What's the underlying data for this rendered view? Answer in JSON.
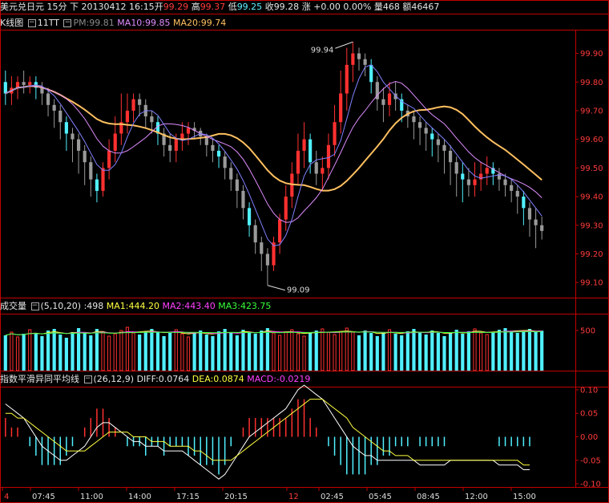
{
  "header": {
    "symbol": "美元兑日元",
    "period": "15分",
    "direction": "下",
    "datetime": "20130412 16:15",
    "open_label": "开",
    "open": "99.29",
    "high_label": "高",
    "high": "99.37",
    "low_label": "低",
    "low": "99.25",
    "close_label": "收",
    "close": "99.28",
    "change_label": "涨",
    "change": "+0.00",
    "change_pct": "0.00%",
    "volume_label": "量",
    "volume": "468",
    "amount_label": "额",
    "amount": "46467"
  },
  "kline_legend": {
    "title": "K线图",
    "indicator": "11TT",
    "pm": "PM:99.81",
    "ma10": "MA10:99.85",
    "ma20": "MA20:99.74"
  },
  "volume_legend": {
    "title": "成交量",
    "params": "(5,10,20)",
    "value": ":498",
    "ma1": "MA1:444.20",
    "ma2": "MA2:443.40",
    "ma3": "MA3:423.75"
  },
  "macd_legend": {
    "title": "指数平滑异同平均线",
    "params": "(26,12,9)",
    "diff": "DIFF:0.0764",
    "dea": "DEA:0.0874",
    "macd": "MACD:-0.0219"
  },
  "annotations": {
    "high_mark": "99.94",
    "low_mark": "99.09"
  },
  "colors": {
    "up": "#ff3030",
    "down_gray": "#9a9a9a",
    "down_cyan": "#50f0ff",
    "ma20": "#ffc060",
    "ma10": "#e08cff",
    "pm": "#8080ff",
    "frame": "#c00000",
    "axis_text": "#ff3b3b"
  },
  "chart_data": [
    {
      "type": "candlestick",
      "title": "K线图",
      "y_ticks": [
        "99.90",
        "99.80",
        "99.70",
        "99.60",
        "99.50",
        "99.40",
        "99.30",
        "99.20",
        "99.10"
      ],
      "ylim": [
        99.05,
        99.98
      ],
      "open": [
        99.8,
        99.76,
        99.78,
        99.8,
        99.79,
        99.8,
        99.78,
        99.76,
        99.72,
        99.7,
        99.66,
        99.62,
        99.6,
        99.56,
        99.52,
        99.46,
        99.42,
        99.5,
        99.56,
        99.62,
        99.66,
        99.7,
        99.74,
        99.72,
        99.68,
        99.66,
        99.62,
        99.58,
        99.56,
        99.6,
        99.62,
        99.64,
        99.63,
        99.61,
        99.58,
        99.56,
        99.54,
        99.5,
        99.46,
        99.42,
        99.36,
        99.3,
        99.24,
        99.2,
        99.16,
        99.24,
        99.32,
        99.4,
        99.48,
        99.56,
        99.6,
        99.52,
        99.48,
        99.5,
        99.58,
        99.66,
        99.76,
        99.86,
        99.9,
        99.88,
        99.86,
        99.8,
        99.74,
        99.72,
        99.76,
        99.74,
        99.7,
        99.68,
        99.66,
        99.64,
        99.62,
        99.6,
        99.58,
        99.56,
        99.52,
        99.48,
        99.46,
        99.44,
        99.46,
        99.48,
        99.5,
        99.48,
        99.46,
        99.44,
        99.42,
        99.4,
        99.36,
        99.32,
        99.3
      ],
      "high": [
        99.84,
        99.82,
        99.82,
        99.84,
        99.82,
        99.82,
        99.8,
        99.78,
        99.74,
        99.72,
        99.68,
        99.64,
        99.62,
        99.58,
        99.54,
        99.48,
        99.52,
        99.6,
        99.68,
        99.76,
        99.76,
        99.76,
        99.76,
        99.74,
        99.7,
        99.68,
        99.64,
        99.62,
        99.62,
        99.66,
        99.66,
        99.66,
        99.64,
        99.62,
        99.6,
        99.58,
        99.56,
        99.52,
        99.48,
        99.44,
        99.38,
        99.32,
        99.26,
        99.22,
        99.26,
        99.34,
        99.44,
        99.52,
        99.62,
        99.66,
        99.62,
        99.56,
        99.54,
        99.62,
        99.72,
        99.84,
        99.92,
        99.94,
        99.92,
        99.9,
        99.88,
        99.82,
        99.78,
        99.8,
        99.8,
        99.76,
        99.72,
        99.7,
        99.68,
        99.66,
        99.64,
        99.62,
        99.6,
        99.58,
        99.54,
        99.52,
        99.5,
        99.52,
        99.52,
        99.54,
        99.52,
        99.5,
        99.48,
        99.46,
        99.44,
        99.42,
        99.38,
        99.36,
        99.33
      ],
      "low": [
        99.72,
        99.72,
        99.74,
        99.76,
        99.76,
        99.74,
        99.72,
        99.68,
        99.64,
        99.6,
        99.56,
        99.52,
        99.48,
        99.44,
        99.4,
        99.38,
        99.4,
        99.46,
        99.52,
        99.58,
        99.62,
        99.66,
        99.68,
        99.64,
        99.62,
        99.58,
        99.54,
        99.52,
        99.52,
        99.56,
        99.58,
        99.6,
        99.58,
        99.54,
        99.52,
        99.5,
        99.46,
        99.42,
        99.36,
        99.32,
        99.26,
        99.2,
        99.14,
        99.09,
        99.14,
        99.2,
        99.28,
        99.36,
        99.44,
        99.5,
        99.48,
        99.44,
        99.42,
        99.46,
        99.54,
        99.62,
        99.7,
        99.8,
        99.84,
        99.82,
        99.76,
        99.7,
        99.66,
        99.68,
        99.7,
        99.66,
        99.64,
        99.6,
        99.58,
        99.56,
        99.54,
        99.52,
        99.48,
        99.44,
        99.4,
        99.38,
        99.4,
        99.4,
        99.42,
        99.44,
        99.44,
        99.42,
        99.4,
        99.38,
        99.34,
        99.3,
        99.26,
        99.22,
        99.25
      ],
      "close": [
        99.76,
        99.78,
        99.8,
        99.79,
        99.8,
        99.78,
        99.76,
        99.72,
        99.7,
        99.66,
        99.62,
        99.6,
        99.56,
        99.52,
        99.46,
        99.42,
        99.5,
        99.56,
        99.62,
        99.66,
        99.7,
        99.74,
        99.72,
        99.68,
        99.66,
        99.62,
        99.58,
        99.56,
        99.6,
        99.62,
        99.64,
        99.63,
        99.61,
        99.58,
        99.56,
        99.54,
        99.5,
        99.46,
        99.42,
        99.36,
        99.3,
        99.24,
        99.2,
        99.16,
        99.24,
        99.32,
        99.4,
        99.48,
        99.56,
        99.6,
        99.52,
        99.48,
        99.5,
        99.58,
        99.66,
        99.76,
        99.86,
        99.9,
        99.88,
        99.86,
        99.8,
        99.74,
        99.72,
        99.76,
        99.74,
        99.7,
        99.68,
        99.66,
        99.64,
        99.62,
        99.6,
        99.58,
        99.56,
        99.52,
        99.48,
        99.46,
        99.44,
        99.46,
        99.48,
        99.5,
        99.48,
        99.46,
        99.44,
        99.42,
        99.4,
        99.36,
        99.32,
        99.3,
        99.28
      ]
    },
    {
      "type": "bar",
      "title": "成交量",
      "y_ticks": [
        "500"
      ],
      "ylim": [
        0,
        700
      ],
      "values": [
        440,
        480,
        420,
        460,
        510,
        470,
        430,
        500,
        520,
        450,
        410,
        480,
        530,
        470,
        440,
        520,
        480,
        430,
        460,
        500,
        540,
        470,
        450,
        490,
        520,
        480,
        430,
        470,
        510,
        460,
        420,
        480,
        500,
        450,
        430,
        490,
        520,
        470,
        440,
        510,
        480,
        460,
        500,
        530,
        470,
        440,
        480,
        510,
        460,
        430,
        470,
        500,
        520,
        480,
        450,
        490,
        530,
        480,
        440,
        500,
        470,
        430,
        480,
        510,
        460,
        440,
        490,
        520,
        480,
        450,
        500,
        470,
        430,
        480,
        510,
        460,
        490,
        520,
        470,
        450,
        480,
        510,
        530,
        490,
        470,
        500,
        520,
        480,
        498
      ]
    },
    {
      "type": "line",
      "title": "指数平滑异同平均线",
      "y_ticks": [
        "0.10",
        "0.05",
        "0.00",
        "-0.05",
        "-0.10"
      ],
      "ylim": [
        -0.105,
        0.105
      ],
      "series": [
        {
          "name": "DIFF",
          "values": [
            0.07,
            0.06,
            0.05,
            0.04,
            0.02,
            0.0,
            -0.02,
            -0.03,
            -0.04,
            -0.05,
            -0.05,
            -0.04,
            -0.03,
            -0.02,
            0.0,
            0.02,
            0.03,
            0.03,
            0.02,
            0.01,
            0.0,
            -0.01,
            -0.01,
            -0.02,
            -0.02,
            -0.02,
            -0.03,
            -0.03,
            -0.03,
            -0.03,
            -0.04,
            -0.05,
            -0.06,
            -0.07,
            -0.08,
            -0.09,
            -0.08,
            -0.06,
            -0.04,
            -0.02,
            0.0,
            0.01,
            0.02,
            0.03,
            0.04,
            0.05,
            0.06,
            0.08,
            0.1,
            0.11,
            0.1,
            0.09,
            0.08,
            0.06,
            0.04,
            0.02,
            0.0,
            -0.02,
            -0.03,
            -0.04,
            -0.04,
            -0.05,
            -0.05,
            -0.05,
            -0.05,
            -0.05,
            -0.05,
            -0.05,
            -0.06,
            -0.06,
            -0.06,
            -0.06,
            -0.06,
            -0.05,
            -0.05,
            -0.05,
            -0.05,
            -0.05,
            -0.05,
            -0.05,
            -0.05,
            -0.06,
            -0.06,
            -0.06,
            -0.06,
            -0.07,
            -0.07
          ]
        },
        {
          "name": "DEA",
          "values": [
            0.05,
            0.05,
            0.04,
            0.04,
            0.03,
            0.02,
            0.01,
            0.0,
            -0.01,
            -0.02,
            -0.03,
            -0.03,
            -0.03,
            -0.03,
            -0.02,
            -0.01,
            0.0,
            0.01,
            0.01,
            0.01,
            0.01,
            0.0,
            0.0,
            0.0,
            -0.01,
            -0.01,
            -0.01,
            -0.02,
            -0.02,
            -0.02,
            -0.02,
            -0.03,
            -0.03,
            -0.04,
            -0.05,
            -0.05,
            -0.05,
            -0.05,
            -0.04,
            -0.03,
            -0.02,
            -0.01,
            0.0,
            0.01,
            0.02,
            0.03,
            0.04,
            0.05,
            0.06,
            0.07,
            0.08,
            0.08,
            0.08,
            0.07,
            0.06,
            0.05,
            0.04,
            0.02,
            0.01,
            0.0,
            -0.01,
            -0.02,
            -0.03,
            -0.03,
            -0.04,
            -0.04,
            -0.04,
            -0.05,
            -0.05,
            -0.05,
            -0.05,
            -0.05,
            -0.05,
            -0.05,
            -0.05,
            -0.05,
            -0.05,
            -0.05,
            -0.05,
            -0.05,
            -0.05,
            -0.05,
            -0.05,
            -0.05,
            -0.05,
            -0.06,
            -0.06
          ]
        }
      ]
    }
  ],
  "time_axis": [
    "4",
    "07:45",
    "11:00",
    "14:00",
    "17:15",
    "20:15",
    "12",
    "02:45",
    "05:45",
    "08:45",
    "12:00",
    "15:00"
  ]
}
